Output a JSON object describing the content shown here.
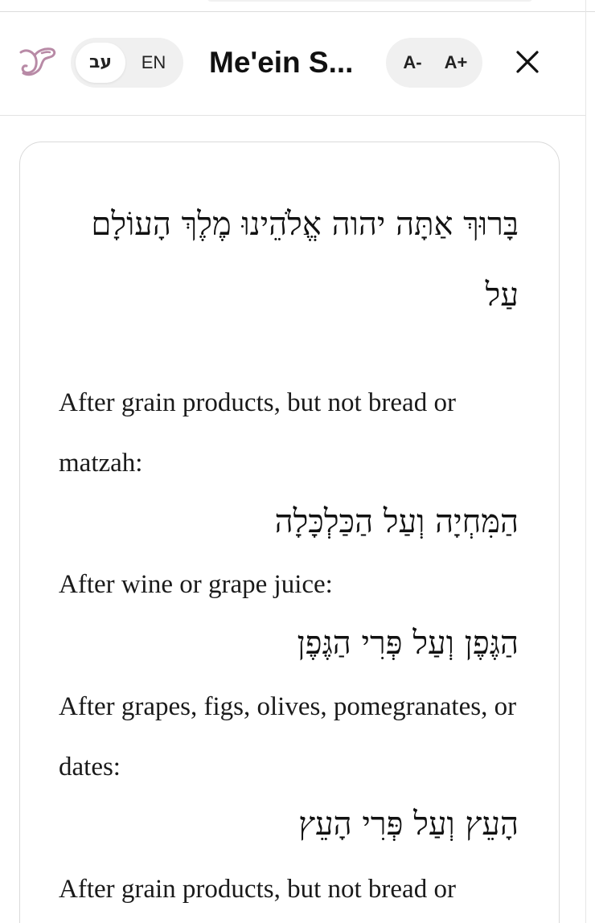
{
  "header": {
    "title": "Me'ein S...",
    "lang_toggle": {
      "hebrew_label": "עב",
      "english_label": "EN",
      "selected": "hebrew"
    },
    "font_controls": {
      "decrease_label": "A-",
      "increase_label": "A+"
    },
    "close_icon": "close-icon",
    "logo_icon": "sefaria-logo-icon"
  },
  "colors": {
    "logo": "#b88aa6",
    "pill_bg": "#f0f0f0",
    "border": "#dadada",
    "text": "#111111"
  },
  "content": {
    "hebrew_intro": "בָּרוּךְ אַתָּה יהוה אֱלֹהֵינוּ מֶלֶךְ הָעוֹלָם עַל",
    "sections": [
      {
        "english": "After grain products, but not bread or matzah:",
        "hebrew": "הַמִּחְיָה וְעַל הַכַּלְכָּלָה"
      },
      {
        "english": "After wine or grape juice:",
        "hebrew": "הַגֶּפֶן וְעַל פְּרִי הַגֶּפֶן"
      },
      {
        "english": "After grapes, figs, olives, pomegranates, or dates:",
        "hebrew": "הָעֵץ וְעַל פְּרִי הָעֵץ"
      },
      {
        "english": "After grain products, but not bread or"
      }
    ]
  }
}
